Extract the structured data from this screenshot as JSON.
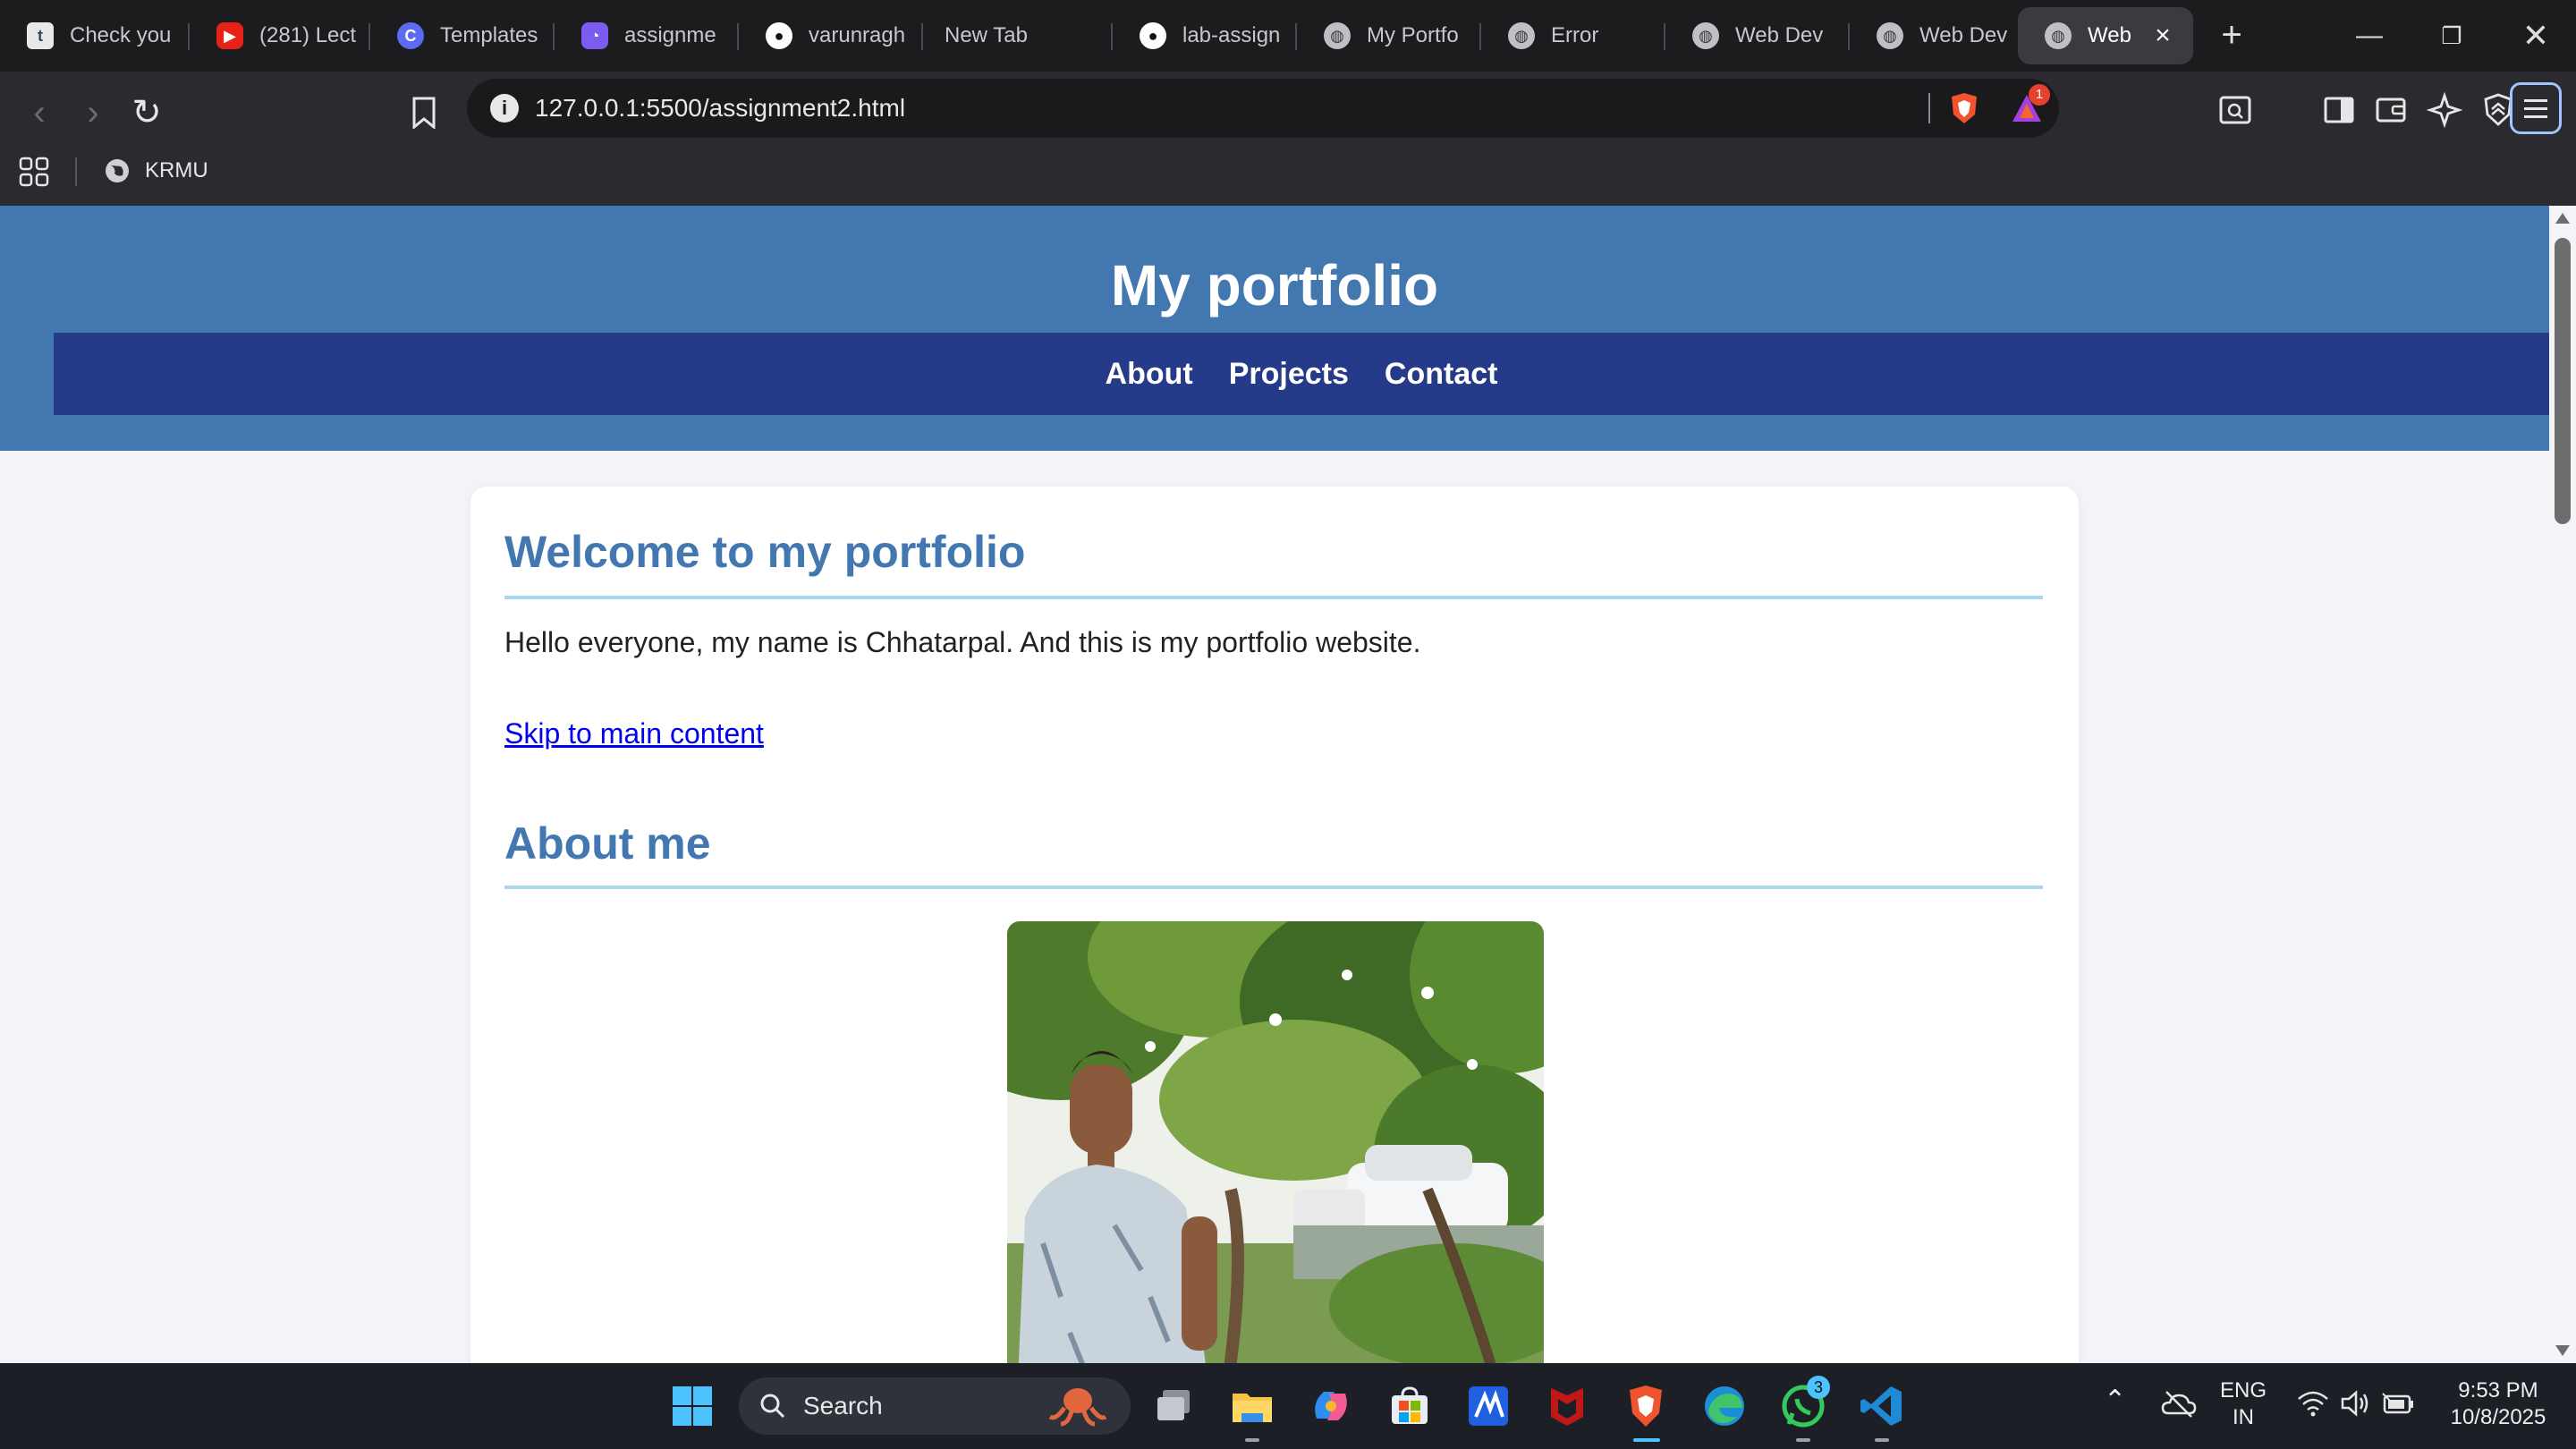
{
  "browser": {
    "tabs": [
      {
        "label": "Check you",
        "icon": "tumblr-icon"
      },
      {
        "label": "(281) Lect",
        "icon": "youtube-icon"
      },
      {
        "label": "Templates",
        "icon": "canva-icon"
      },
      {
        "label": "assignme",
        "icon": "app-icon"
      },
      {
        "label": "varunragh",
        "icon": "github-icon"
      },
      {
        "label": "New Tab",
        "icon": ""
      },
      {
        "label": "lab-assign",
        "icon": "github-icon"
      },
      {
        "label": "My Portfo",
        "icon": "globe-icon"
      },
      {
        "label": "Error",
        "icon": "globe-icon"
      },
      {
        "label": "Web Dev",
        "icon": "globe-icon"
      },
      {
        "label": "Web Dev",
        "icon": "globe-icon"
      },
      {
        "label": "Web",
        "icon": "globe-icon",
        "active": true
      }
    ],
    "new_tab_label": "+",
    "url": "127.0.0.1:5500/assignment2.html",
    "rewards_badge": "1",
    "bookmarks": [
      {
        "label": "KRMU",
        "icon": "globe-icon"
      }
    ]
  },
  "page": {
    "site_title": "My portfolio",
    "nav": [
      "About",
      "Projects",
      "Contact"
    ],
    "welcome_heading": "Welcome to my portfolio",
    "intro_text": "Hello everyone, my name is Chhatarpal. And this is my portfolio website.",
    "skip_link": "Skip to main content",
    "about_heading": "About me",
    "colors": {
      "header": "#4277b0",
      "nav": "#253b8a",
      "heading": "#4277b0",
      "rule": "#a8d8f0"
    }
  },
  "taskbar": {
    "search_label": "Search",
    "language": "ENG",
    "region": "IN",
    "time": "9:53 PM",
    "date": "10/8/2025",
    "whatsapp_badge": "3"
  }
}
